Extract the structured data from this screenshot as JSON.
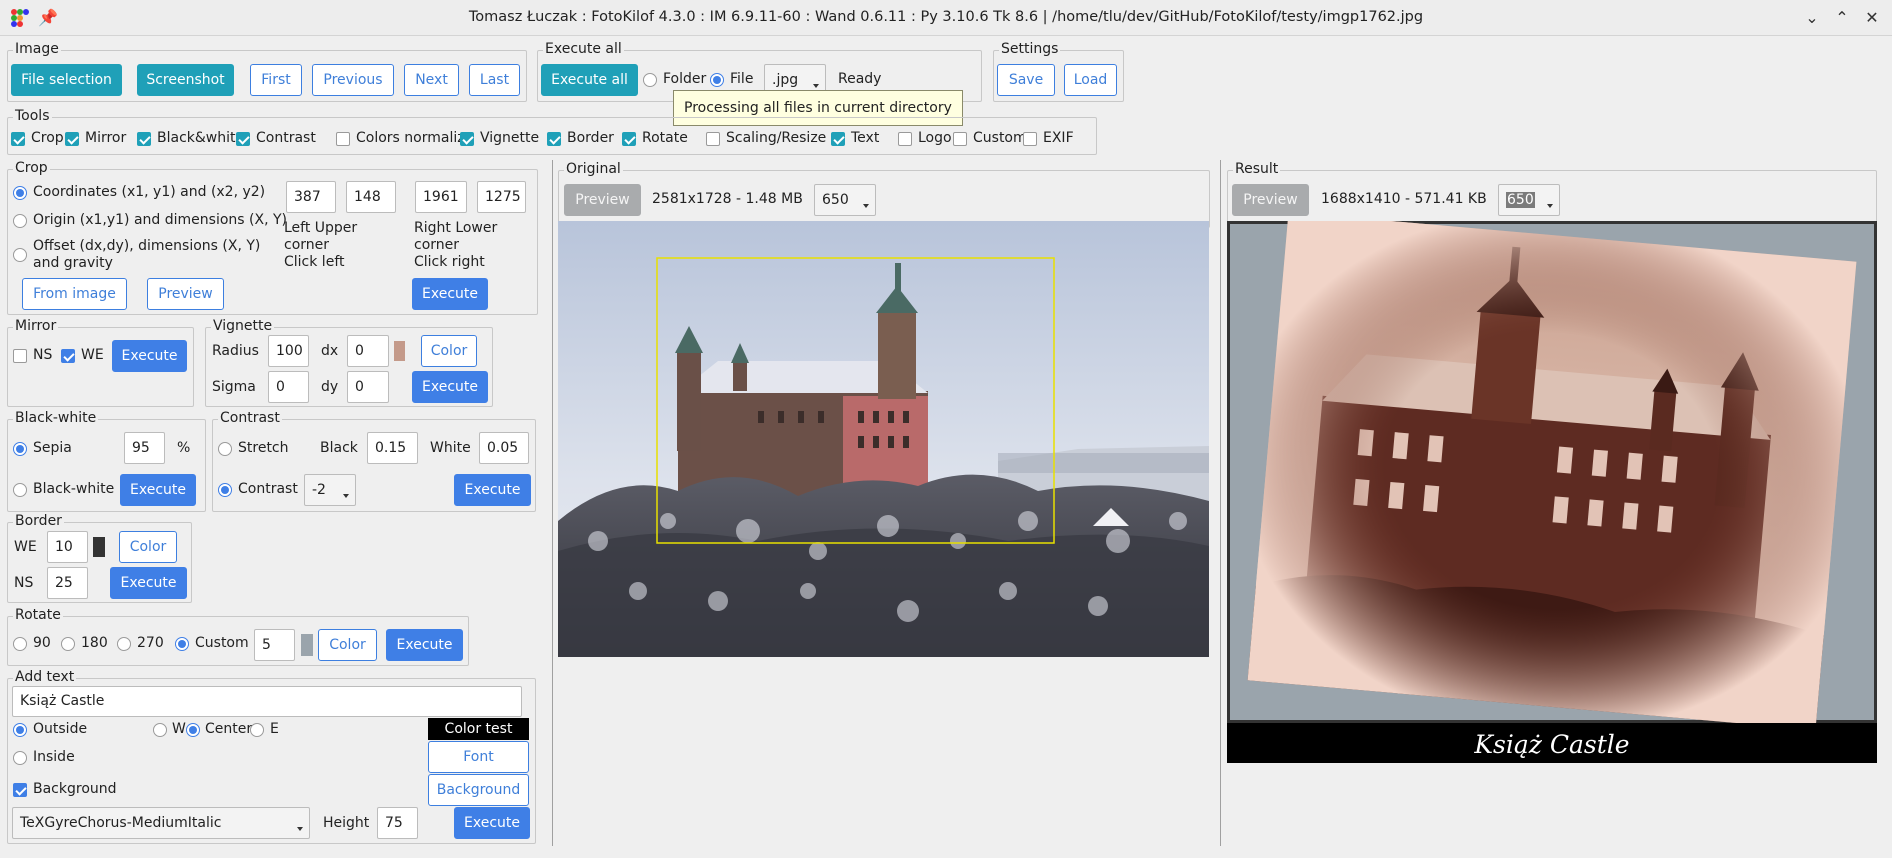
{
  "window": {
    "title": "Tomasz Łuczak : FotoKilof 4.3.0 : IM 6.9.11-60 : Wand 0.6.11 : Py 3.10.6 Tk 8.6 | /home/tlu/dev/GitHub/FotoKilof/testy/imgp1762.jpg"
  },
  "image_group": {
    "label": "Image",
    "file_selection": "File selection",
    "screenshot": "Screenshot",
    "first": "First",
    "previous": "Previous",
    "next": "Next",
    "last": "Last"
  },
  "execute_all": {
    "label": "Execute all",
    "button": "Execute all",
    "folder": "Folder",
    "file": "File",
    "extension": ".jpg",
    "status": "Ready",
    "tooltip": "Processing all files in current directory"
  },
  "settings": {
    "label": "Settings",
    "save": "Save",
    "load": "Load"
  },
  "tools": {
    "label": "Tools",
    "items": [
      {
        "label": "Crop",
        "checked": true
      },
      {
        "label": "Mirror",
        "checked": true
      },
      {
        "label": "Black&white",
        "checked": true
      },
      {
        "label": "Contrast",
        "checked": true
      },
      {
        "label": "Colors normalize",
        "checked": false
      },
      {
        "label": "Vignette",
        "checked": true
      },
      {
        "label": "Border",
        "checked": true
      },
      {
        "label": "Rotate",
        "checked": true
      },
      {
        "label": "Scaling/Resize",
        "checked": false
      },
      {
        "label": "Text",
        "checked": true
      },
      {
        "label": "Logo",
        "checked": false
      },
      {
        "label": "Custom",
        "checked": false
      },
      {
        "label": "EXIF",
        "checked": false
      }
    ]
  },
  "crop": {
    "label": "Crop",
    "opt1": "Coordinates (x1, y1) and (x2, y2)",
    "opt2": "Origin (x1,y1) and dimensions (X, Y)",
    "opt3_line1": "Offset (dx,dy), dimensions (X, Y)",
    "opt3_line2": "and gravity",
    "x1": "387",
    "y1": "148",
    "x2": "1961",
    "y2": "1275",
    "left_upper_1": "Left Upper",
    "left_upper_2": "corner",
    "left_upper_3": "Click left",
    "right_lower_1": "Right Lower",
    "right_lower_2": "corner",
    "right_lower_3": "Click right",
    "from_image": "From image",
    "preview": "Preview",
    "execute": "Execute"
  },
  "mirror": {
    "label": "Mirror",
    "ns": "NS",
    "we": "WE",
    "ns_checked": false,
    "we_checked": true,
    "execute": "Execute"
  },
  "vignette": {
    "label": "Vignette",
    "radius_label": "Radius",
    "radius": "100",
    "dx_label": "dx",
    "dx": "0",
    "sigma_label": "Sigma",
    "sigma": "0",
    "dy_label": "dy",
    "dy": "0",
    "color_swatch": "#c49a8a",
    "color": "Color",
    "execute": "Execute"
  },
  "black_white": {
    "label": "Black-white",
    "sepia": "Sepia",
    "sepia_value": "95",
    "percent": "%",
    "bw": "Black-white",
    "execute": "Execute"
  },
  "contrast": {
    "label": "Contrast",
    "stretch": "Stretch",
    "black_label": "Black",
    "black": "0.15",
    "white_label": "White",
    "white": "0.05",
    "contrast": "Contrast",
    "contrast_value": "-2",
    "execute": "Execute"
  },
  "border": {
    "label": "Border",
    "we_label": "WE",
    "we": "10",
    "ns_label": "NS",
    "ns": "25",
    "color_swatch": "#333333",
    "color": "Color",
    "execute": "Execute"
  },
  "rotate": {
    "label": "Rotate",
    "r90": "90",
    "r180": "180",
    "r270": "270",
    "custom": "Custom",
    "custom_value": "5",
    "color_swatch": "#9aa4ac",
    "color": "Color",
    "execute": "Execute"
  },
  "add_text": {
    "label": "Add text",
    "text": "Książ Castle",
    "outside": "Outside",
    "inside": "Inside",
    "w": "W",
    "center": "Center",
    "e": "E",
    "color_test": "Color test",
    "font": "Font",
    "background_check": "Background",
    "background_btn": "Background",
    "font_name": "TeXGyreChorus-MediumItalic",
    "height_label": "Height",
    "height": "75",
    "execute": "Execute"
  },
  "original": {
    "label": "Original",
    "preview": "Preview",
    "info": "2581x1728 - 1.48 MB",
    "size": "650"
  },
  "result": {
    "label": "Result",
    "preview": "Preview",
    "info": "1688x1410 - 571.41 KB",
    "size": "650",
    "caption": "Książ Castle"
  },
  "colors": {
    "teal": "#1fa0b8",
    "blue": "#3f7fe6",
    "crop_rect": "#e8e000"
  }
}
